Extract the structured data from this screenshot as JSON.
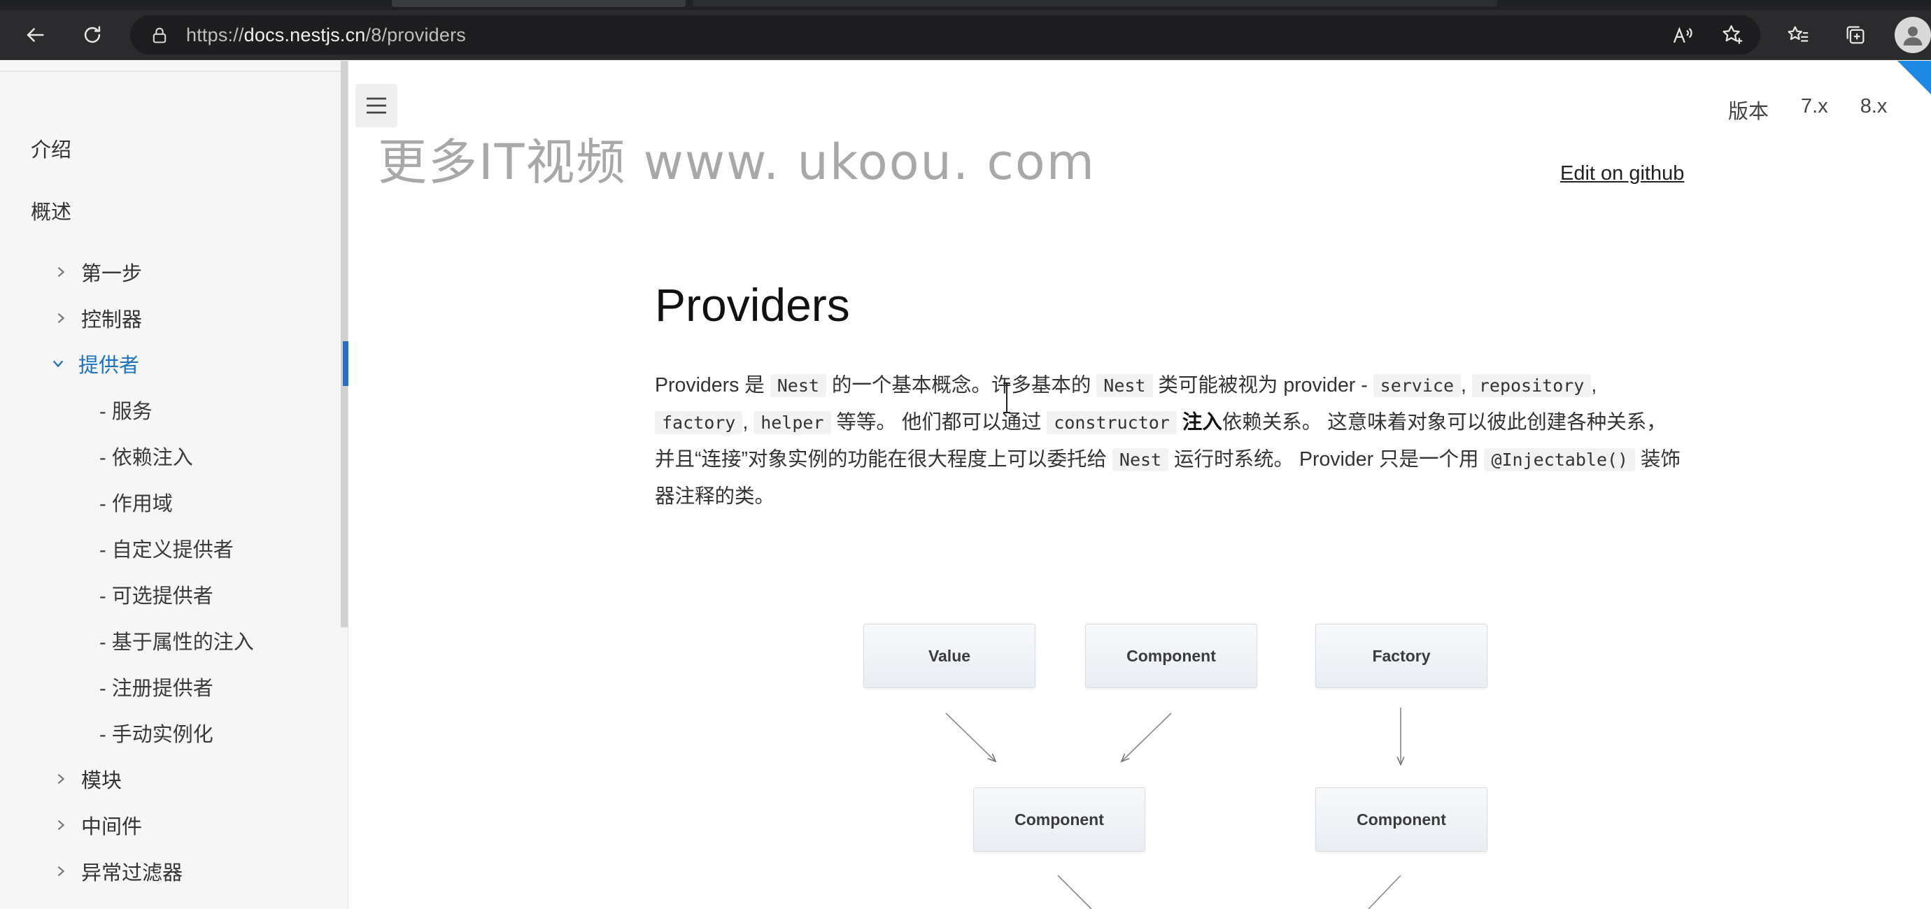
{
  "browser": {
    "url_prefix": "https://",
    "url_host": "docs.nestjs.cn",
    "url_path": "/8/providers"
  },
  "sidebar": {
    "top_items": [
      {
        "label": "介绍"
      },
      {
        "label": "概述"
      }
    ],
    "groups": [
      {
        "label": "第一步"
      },
      {
        "label": "控制器"
      },
      {
        "label": "提供者",
        "active": true
      }
    ],
    "sub_items": [
      {
        "label": "- 服务"
      },
      {
        "label": "- 依赖注入"
      },
      {
        "label": "- 作用域"
      },
      {
        "label": "- 自定义提供者"
      },
      {
        "label": "- 可选提供者"
      },
      {
        "label": "- 基于属性的注入"
      },
      {
        "label": "- 注册提供者"
      },
      {
        "label": "- 手动实例化"
      }
    ],
    "groups_after": [
      {
        "label": "模块"
      },
      {
        "label": "中间件"
      },
      {
        "label": "异常过滤器"
      }
    ]
  },
  "watermark": "更多IT视频 www. ukoou. com",
  "versions": {
    "label": "版本",
    "options": [
      "7.x",
      "8.x"
    ]
  },
  "edit_link": "Edit on github",
  "page": {
    "title": "Providers",
    "intro": {
      "t1": "Providers 是 ",
      "c1": "Nest",
      "t2": " 的一个基本概念。许多基本的 ",
      "c2": "Nest",
      "t3": " 类可能被视为 provider - ",
      "c3": "service",
      "t4": ", ",
      "c4": "repository",
      "t5": ", ",
      "c5": "factory",
      "t6": ", ",
      "c6": "helper",
      "t7": " 等等。 他们都可以通过 ",
      "c7": "constructor",
      "t8": " ",
      "b1": "注入",
      "t9": "依赖关系。 这意味着对象可以彼此创建各种关系，并且“连接”对象实例的功能在很大程度上可以委托给 ",
      "c8": "Nest",
      "t10": " 运行时系统。 Provider 只是一个用 ",
      "c9": "@Injectable()",
      "t11": " 装饰器注释的类。"
    }
  },
  "diagram": {
    "row1": [
      "Value",
      "Component",
      "Factory"
    ],
    "row2": [
      "Component",
      "Component"
    ]
  }
}
